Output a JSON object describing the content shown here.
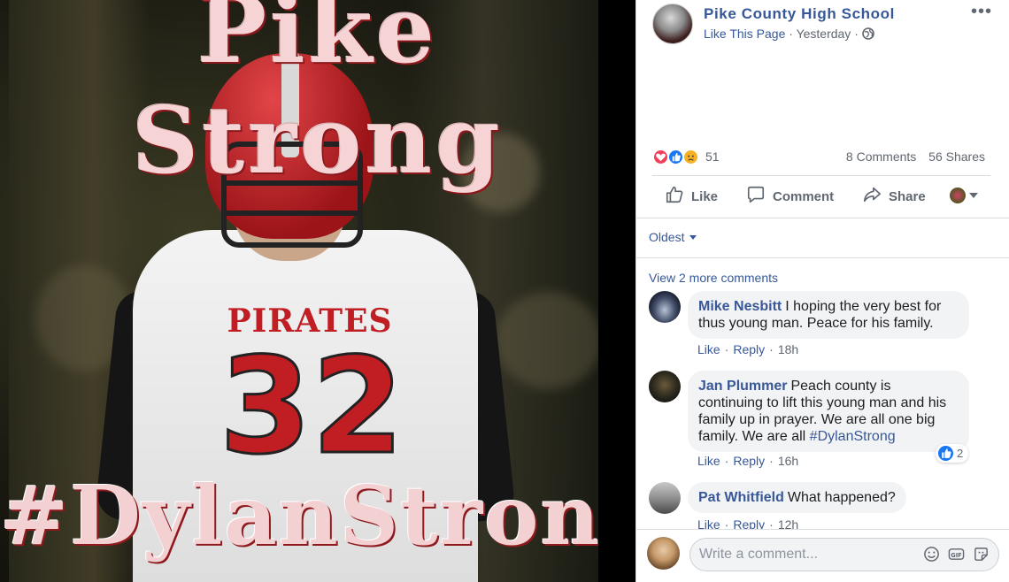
{
  "photo": {
    "headline": "Pike Strong",
    "hashtag": "#DylanStrong",
    "jersey_text": "PIRATES",
    "jersey_number": "32"
  },
  "post": {
    "page_name": "Pike County High School",
    "like_page": "Like This Page",
    "time": "Yesterday",
    "separator": "·",
    "more": "•••",
    "reactions_count": "51",
    "comments_count": "8 Comments",
    "shares_count": "56 Shares"
  },
  "actions": {
    "like": "Like",
    "comment": "Comment",
    "share": "Share"
  },
  "comments_section": {
    "order": "Oldest",
    "view_more": "View 2 more comments",
    "items": [
      {
        "author": "Mike Nesbitt",
        "text": "I hoping the very best for thus young man. Peace for his family.",
        "like": "Like",
        "reply": "Reply",
        "time": "18h"
      },
      {
        "author": "Jan Plummer",
        "text": "Peach county is continuing to lift this young man and his family up in prayer. We are all one big family. We are all ",
        "hashtag": "#DylanStrong",
        "like": "Like",
        "reply": "Reply",
        "time": "16h",
        "reactions": "2"
      },
      {
        "author": "Pat Whitfield",
        "text": "What happened?",
        "like": "Like",
        "reply": "Reply",
        "time": "12h"
      }
    ]
  },
  "composer": {
    "placeholder": "Write a comment..."
  },
  "colors": {
    "link": "#365899",
    "like_blue": "#1877f2",
    "love_red": "#f33e58",
    "sad_yellow": "#f7b125",
    "bubble_bg": "#f2f3f5",
    "jersey_red": "#c11e24"
  }
}
